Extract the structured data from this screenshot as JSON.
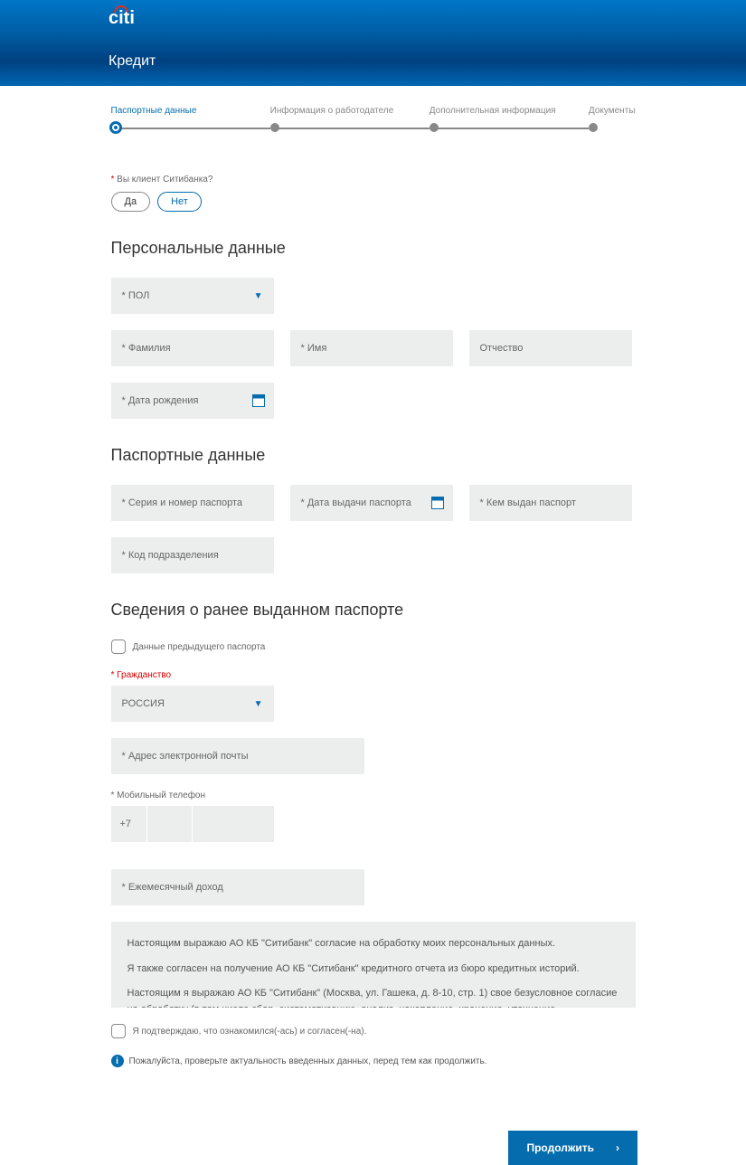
{
  "logo": "citi",
  "page_title": "Кредит",
  "stepper": [
    {
      "label": "Паспортные данные",
      "active": true
    },
    {
      "label": "Информация о работодателе",
      "active": false
    },
    {
      "label": "Дополнительная информация",
      "active": false
    },
    {
      "label": "Документы",
      "active": false
    }
  ],
  "client_question": {
    "label": "Вы клиент Ситибанка?",
    "yes": "Да",
    "no": "Нет"
  },
  "sections": {
    "personal": "Персональные данные",
    "passport": "Паспортные данные",
    "prev_passport": "Сведения о ранее выданном паспорте"
  },
  "fields": {
    "gender": "ПОЛ",
    "surname": "Фамилия",
    "name": "Имя",
    "patronymic": "Отчество",
    "dob": "Дата рождения",
    "passport_sn": "Серия и номер паспорта",
    "passport_date": "Дата выдачи паспорта",
    "passport_by": "Кем выдан паспорт",
    "dept_code": "Код подразделения",
    "prev_checkbox": "Данные предыдущего паспорта",
    "citizenship_label": "Гражданство",
    "citizenship_value": "РОССИЯ",
    "email": "Адрес электронной почты",
    "phone_label": "Мобильный телефон",
    "phone_prefix": "+7",
    "income": "Ежемесячный доход"
  },
  "consent": {
    "p1": "Настоящим выражаю АО КБ \"Ситибанк\" согласие на обработку моих персональных данных.",
    "p2": "Я также согласен на получение АО КБ \"Ситибанк\" кредитного отчета из бюро кредитных историй.",
    "p3": "Настоящим я выражаю АО КБ \"Ситибанк\" (Москва, ул. Гашека, д. 8-10, стр. 1) свое безусловное согласие на обработку (в том числе сбор, систематизацию, анализ, накопление, хранение, уточнение (обновление, изменение), использование, распространение (в том числе передачу, включая трансграничную), обезличивание, блокирование, уничтожение и иные"
  },
  "confirm_label": "Я подтверждаю, что ознакомился(-ась) и согласен(-на).",
  "info_text": "Пожалуйста, проверьте актуальность введенных данных, перед тем как продолжить.",
  "continue_label": "Продолжить"
}
